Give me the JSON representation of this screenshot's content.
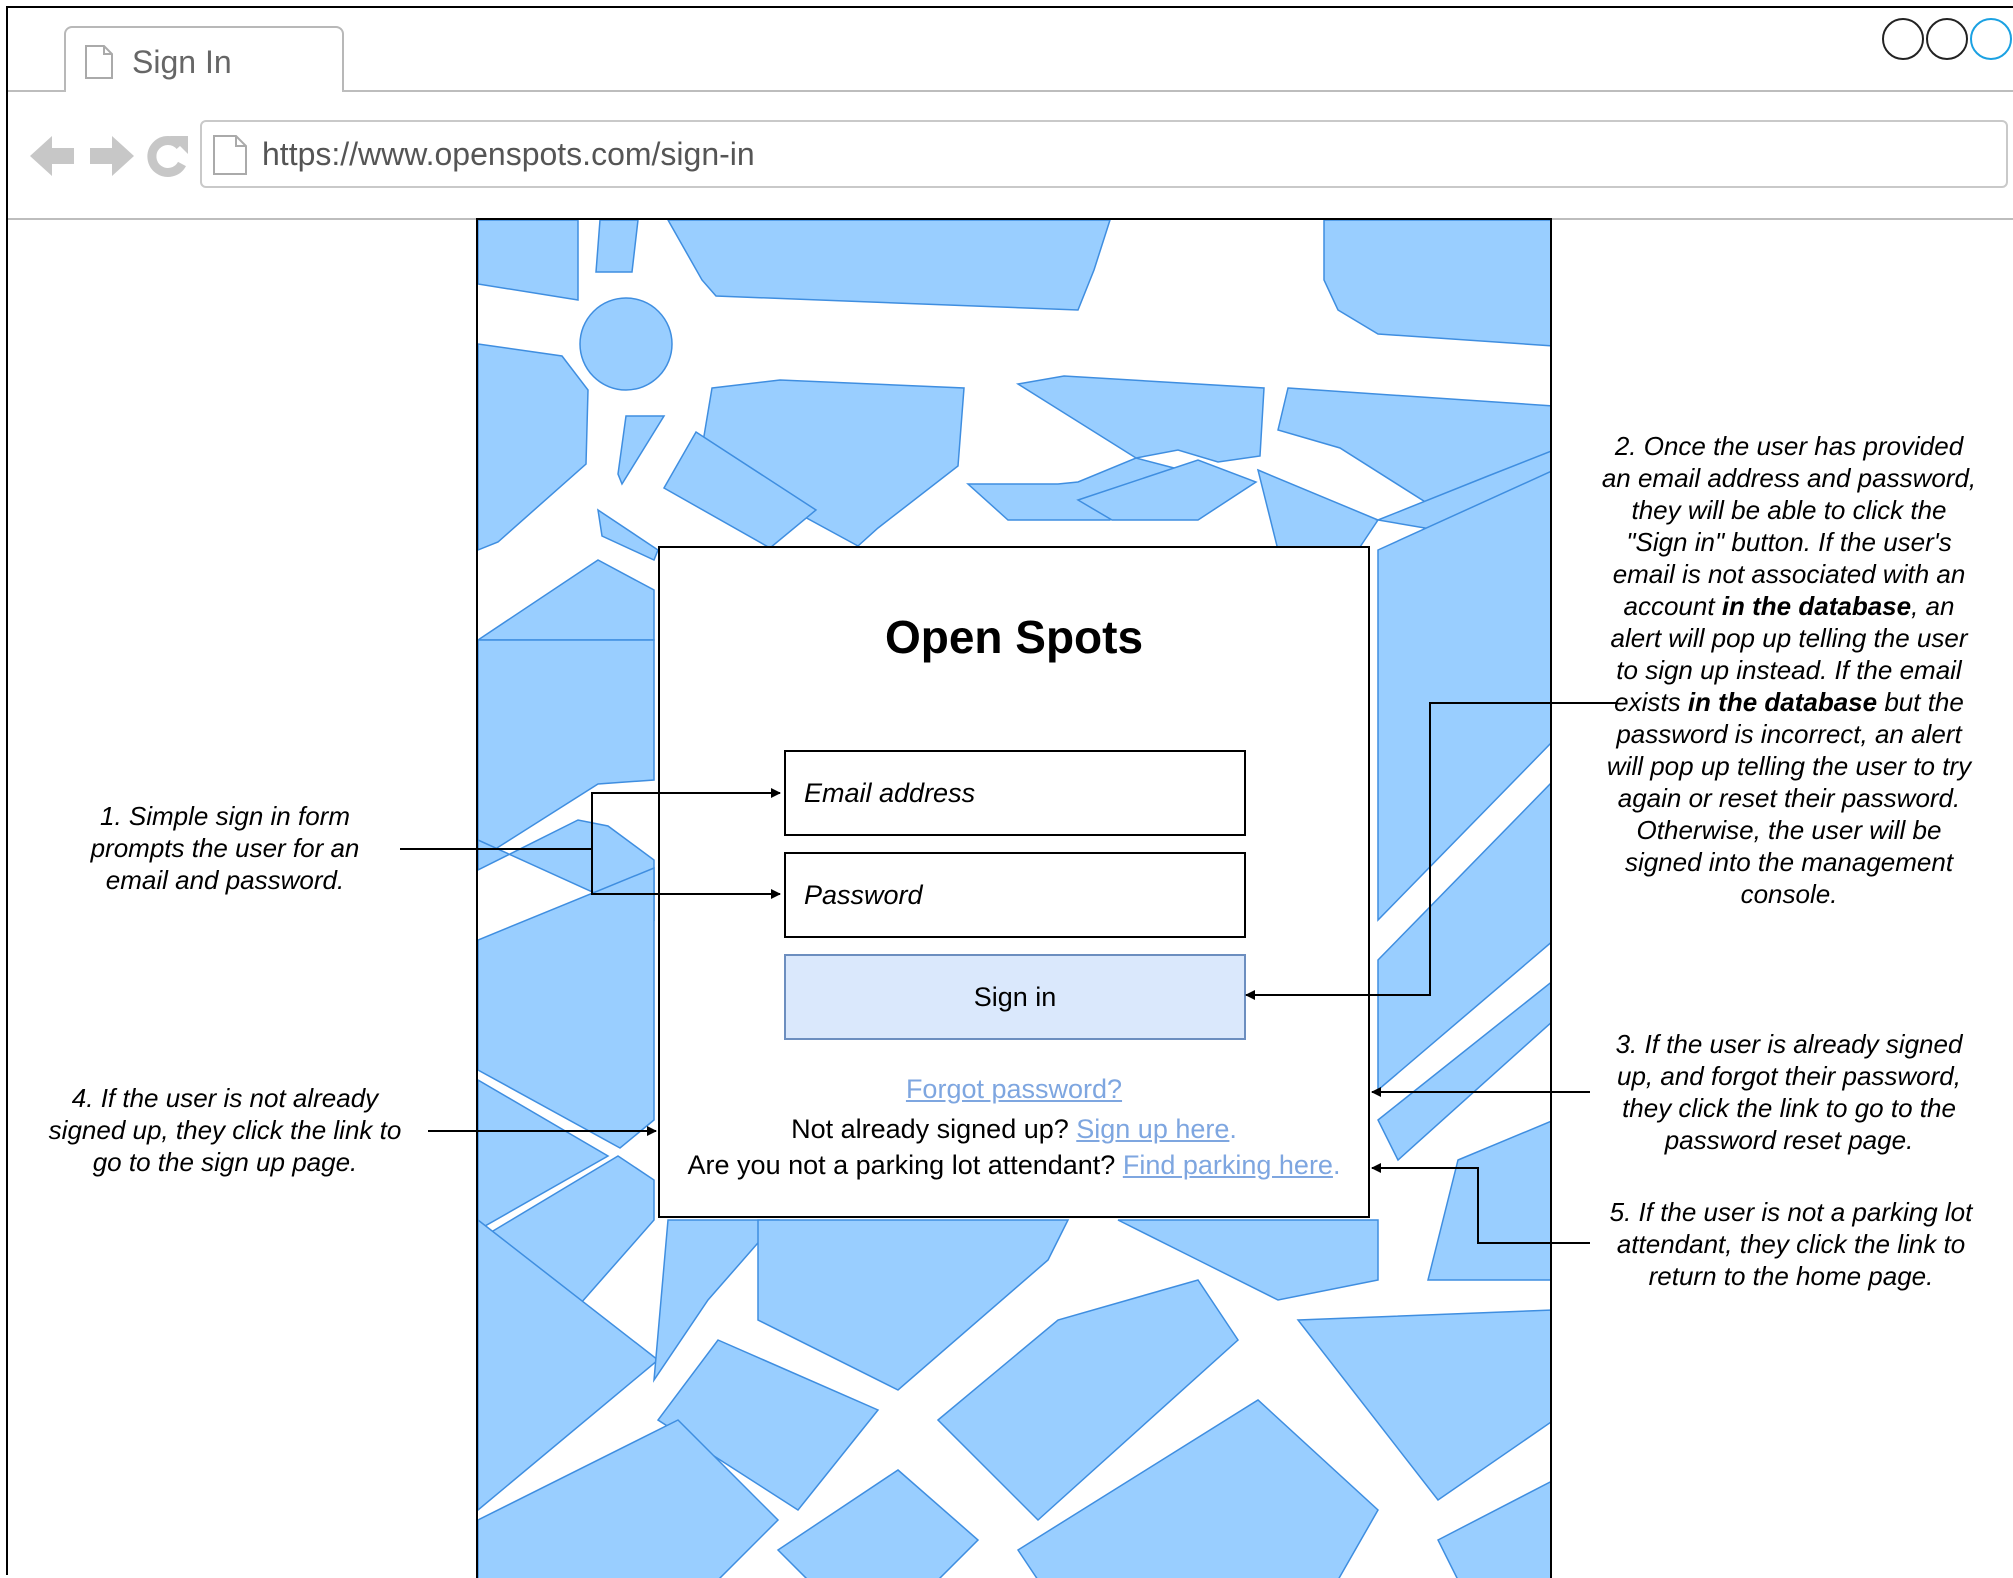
{
  "browser": {
    "tab_title": "Sign In",
    "url": "https://www.openspots.com/sign-in",
    "window_controls": [
      "minimize",
      "maximize",
      "close"
    ],
    "accent_color": "#1ba1e2"
  },
  "map": {
    "block_color": "#99ceff",
    "road_color": "#ffffff",
    "outline_color": "#3f8ee0"
  },
  "signin": {
    "title": "Open Spots",
    "email_placeholder": "Email address",
    "password_placeholder": "Password",
    "button_label": "Sign in",
    "forgot_link": "Forgot password?",
    "signup_prompt": "Not already signed up? ",
    "signup_link": "Sign up here",
    "signup_suffix": ".",
    "parking_prompt": "Are you not a parking lot attendant? ",
    "parking_link": "Find parking here",
    "parking_suffix": ".",
    "button_color": "#dae8fc",
    "link_color": "#7ea6e0"
  },
  "annotations": {
    "note_1": "1. Simple sign in form prompts the user for an email and password.",
    "note_2_part1": "2. Once the user has provided an email address and password, they will be able to click the \"Sign in\" button. If the user's email is not associated with an account ",
    "note_2_bold1": "in the database",
    "note_2_part2": ", an alert will pop up telling the user to sign up instead. If the email exists ",
    "note_2_bold2": "in the database",
    "note_2_part3": " but the password is incorrect, an alert will pop up telling the user to try again or reset their password. Otherwise, the user will be signed into the management console.",
    "note_3": "3. If the user is already signed up, and forgot their password, they click the link to go to the password reset page.",
    "note_4": "4. If the user is not already signed up, they click the link to go to the sign up page.",
    "note_5": "5. If the user is not a parking lot attendant, they click the link to return to the home page."
  }
}
